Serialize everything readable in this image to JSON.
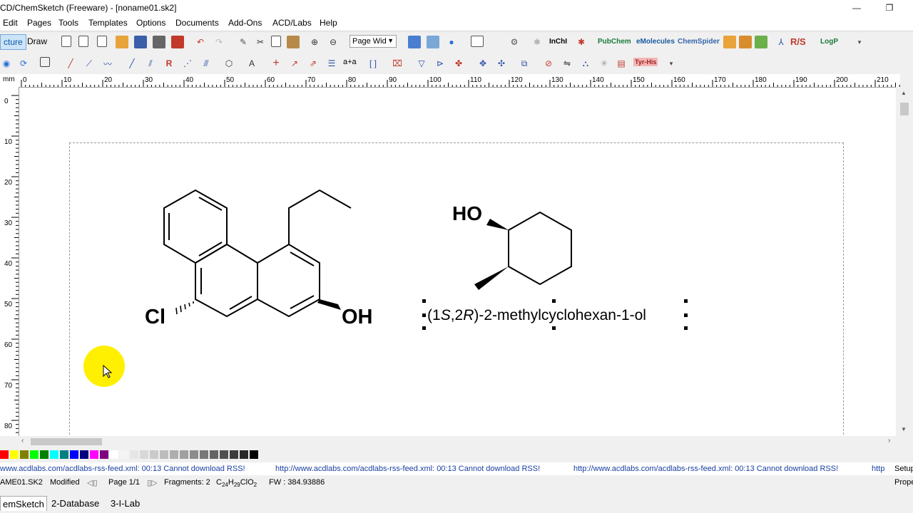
{
  "window": {
    "title": "CD/ChemSketch (Freeware) - [noname01.sk2]",
    "minimize_glyph": "—",
    "restore_glyph": "❐"
  },
  "menu": [
    {
      "label": "Edit"
    },
    {
      "label": "Pages"
    },
    {
      "label": "Tools"
    },
    {
      "label": "Templates"
    },
    {
      "label": "Options"
    },
    {
      "label": "Documents"
    },
    {
      "label": "Add-Ons"
    },
    {
      "label": "ACD/Labs"
    },
    {
      "label": "Help"
    }
  ],
  "toolbar": {
    "mode_structure": "cture",
    "mode_draw": "Draw",
    "zoom_combo": "Page Wid",
    "inchi_label": "InChI",
    "pubchem_label": "PubChem",
    "emolecules_label": "eMolecules",
    "chemspider_label": "ChemSpider",
    "rs_label": "R/S",
    "logp_label": "LogP",
    "aa_label": "a+a",
    "tyr_label": "Tyr-His"
  },
  "ruler": {
    "unit": "mm",
    "top_ticks": [
      "0",
      "10",
      "20",
      "30",
      "40",
      "50",
      "60",
      "70",
      "80",
      "90",
      "100",
      "110",
      "120",
      "130",
      "140",
      "150",
      "160",
      "170",
      "180",
      "190",
      "200",
      "210"
    ],
    "left_ticks": [
      "0",
      "10",
      "20",
      "30",
      "40",
      "50",
      "60",
      "70",
      "80"
    ]
  },
  "canvas": {
    "molecule1": {
      "label_cl": "Cl",
      "label_oh": "OH"
    },
    "molecule2": {
      "label_ho": "HO",
      "name": "(1S,2R)-2-methylcyclohexan-1-ol"
    }
  },
  "rss": {
    "items": [
      "www.acdlabs.com/acdlabs-rss-feed.xml: 00:13 Cannot download RSS!",
      "http://www.acdlabs.com/acdlabs-rss-feed.xml: 00:13 Cannot download RSS!",
      "http://www.acdlabs.com/acdlabs-rss-feed.xml: 00:13 Cannot download RSS!",
      "http"
    ],
    "setup": "Setup"
  },
  "status": {
    "filename": "AME01.SK2",
    "modified": "Modified",
    "page": "Page 1/1",
    "fragments": "Fragments: 2",
    "formula": "C24H29ClO2",
    "fw": "FW : 384.93886",
    "props": "Prope"
  },
  "tabs": [
    {
      "label": "emSketch"
    },
    {
      "label": "2-Database"
    },
    {
      "label": "3-I-Lab"
    }
  ],
  "colors": {
    "accent": "#0b57a8",
    "cursor_highlight": "#ffef00",
    "palette": [
      "#ff0000",
      "#ffff00",
      "#808000",
      "#00ff00",
      "#008000",
      "#00ffff",
      "#008080",
      "#0000ff",
      "#000080",
      "#ff00ff",
      "#800080",
      "#ffffff",
      "#f4f4f4",
      "#e6e6e6",
      "#d8d8d8",
      "#cacaca",
      "#bcbcbc",
      "#aeaeae",
      "#a0a0a0",
      "#8c8c8c",
      "#787878",
      "#646464",
      "#505050",
      "#3c3c3c",
      "#282828",
      "#000000"
    ]
  }
}
